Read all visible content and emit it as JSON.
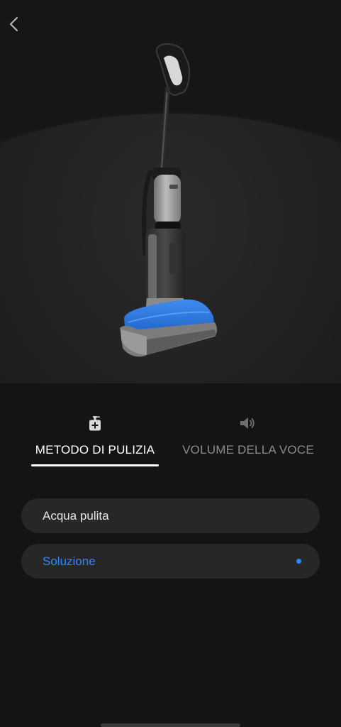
{
  "header": {
    "back_icon": "chevron-left-icon"
  },
  "hero": {
    "device_image": "cordless-wet-dry-vacuum"
  },
  "tabs": [
    {
      "label": "METODO DI PULIZIA",
      "icon": "soap-dispenser-icon",
      "active": true
    },
    {
      "label": "VOLUME DELLA VOCE",
      "icon": "speaker-icon",
      "active": false
    }
  ],
  "options": [
    {
      "label": "Acqua pulita",
      "selected": false
    },
    {
      "label": "Soluzione",
      "selected": true
    }
  ],
  "colors": {
    "background": "#141414",
    "accent": "#2f87ff",
    "option_background": "#272727",
    "inactive_text": "#8a8a8a"
  }
}
